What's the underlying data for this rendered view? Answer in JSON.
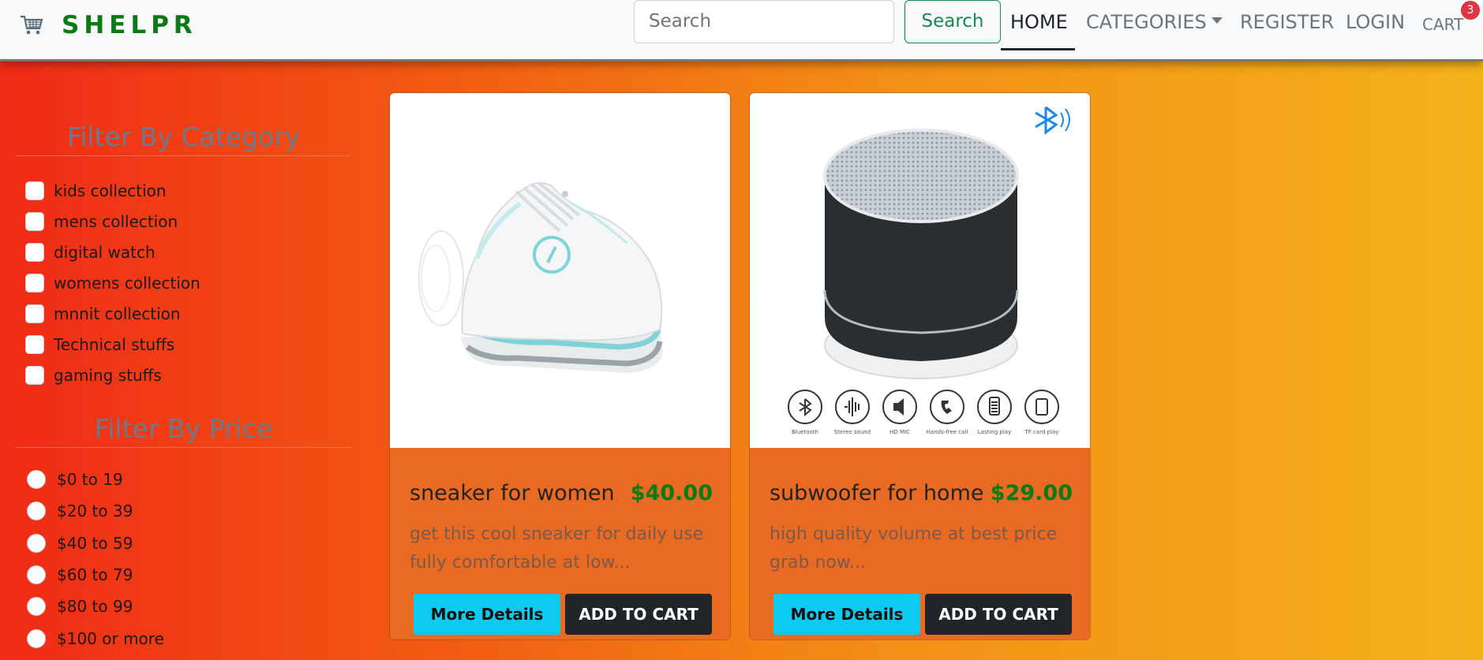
{
  "navbar": {
    "brand": "SHELPR",
    "search_placeholder": "Search",
    "search_button": "Search",
    "links": {
      "home": "HOME",
      "categories": "CATEGORIES",
      "register": "REGISTER",
      "login": "LOGIN",
      "cart": "CART"
    },
    "cart_count": "3"
  },
  "filters": {
    "category_title": "Filter By Category",
    "categories": [
      "kids collection",
      "mens collection",
      "digital watch",
      "womens collection",
      "mnnit collection",
      "Technical stuffs",
      "gaming stuffs"
    ],
    "price_title": "Filter By Price",
    "prices": [
      "$0 to 19",
      "$20 to 39",
      "$40 to 59",
      "$60 to 79",
      "$80 to 99",
      "$100 or more"
    ]
  },
  "products": [
    {
      "name": "sneaker for women",
      "price": "$40.00",
      "description": "get this cool sneaker for daily use fully comfortable at low...",
      "details_button": "More Details",
      "cart_button": "ADD TO CART",
      "image_icon": "sneaker-image"
    },
    {
      "name": "subwoofer for home",
      "price": "$29.00",
      "description": "high quality volume at best price grab now...",
      "details_button": "More Details",
      "cart_button": "ADD TO CART",
      "image_icon": "speaker-image",
      "image_labels": [
        "Bluetooth",
        "Stereo sound",
        "HD MIC",
        "Hands-free call",
        "Lasting play",
        "TF card play"
      ]
    }
  ],
  "colors": {
    "brand": "#0a7a14",
    "price": "#0a7a14",
    "details_button": "#0dcaf0",
    "cart_button": "#212529",
    "badge": "#dc3545"
  }
}
